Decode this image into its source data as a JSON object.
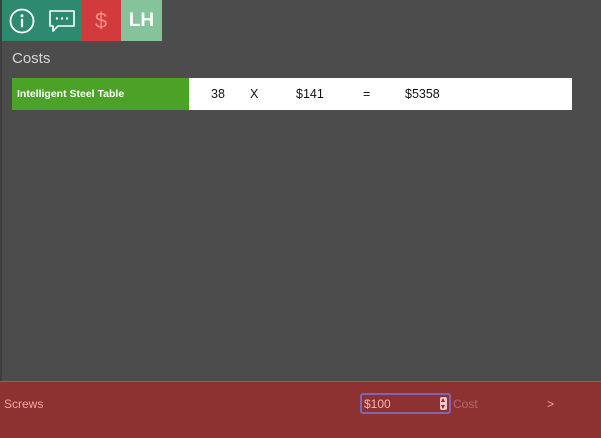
{
  "toolbar": {
    "items": [
      {
        "name": "info",
        "icon": "info-icon",
        "color": "#2d8a6f"
      },
      {
        "name": "comments",
        "icon": "chat-bubble-icon",
        "color": "#2d8a6f"
      },
      {
        "name": "costs",
        "label": "$",
        "icon": "dollar-icon",
        "color": "#d23b3b"
      },
      {
        "name": "user",
        "label": "LH",
        "icon": "avatar",
        "color": "#84c39b"
      }
    ]
  },
  "section": {
    "title": "Costs"
  },
  "costs": {
    "rows": [
      {
        "name": "Intelligent Steel Table",
        "quantity": "38",
        "times": "X",
        "unit_price": "$141",
        "equals": "=",
        "total": "$5358"
      }
    ],
    "name_color": "#4ca127"
  },
  "footer": {
    "label": "Screws",
    "amount_value": "$100",
    "cost_label": "Cost",
    "next_label": ">",
    "color": "#8e3131"
  }
}
